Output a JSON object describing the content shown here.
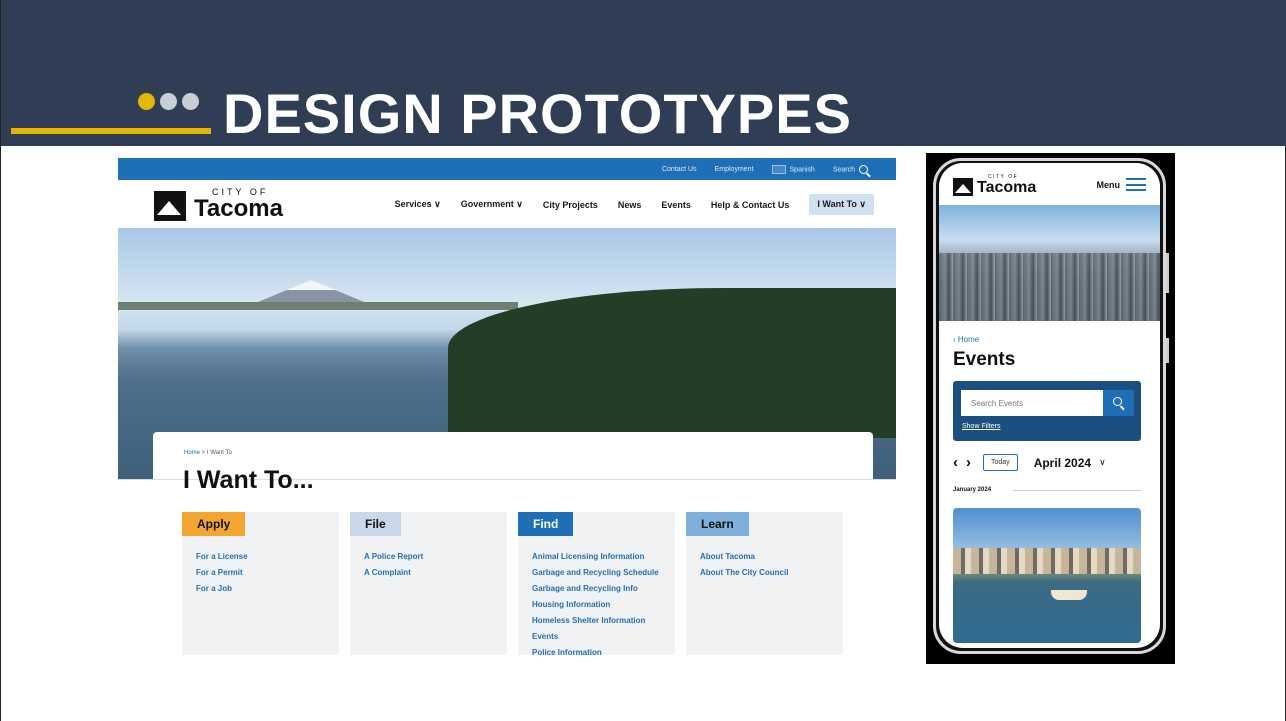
{
  "slide": {
    "title": "DESIGN PROTOTYPES",
    "colors": {
      "header_bg": "#2f3e54",
      "accent": "#e3b600",
      "dot_gray": "#c9cdd4"
    }
  },
  "desktop": {
    "topbar": {
      "contact": "Contact Us",
      "employment": "Employment",
      "spanish": "Spanish",
      "search": "Search"
    },
    "logo": {
      "small": "CITY OF",
      "big": "Tacoma"
    },
    "nav": {
      "services": "Services ∨",
      "government": "Government ∨",
      "city_projects": "City Projects",
      "news": "News",
      "events": "Events",
      "help": "Help & Contact Us",
      "i_want_to": "I Want To ∨"
    },
    "breadcrumb": {
      "home": "Home",
      "sep": " > ",
      "current": "I Want To"
    },
    "page_title": "I Want To...",
    "columns": [
      {
        "label": "Apply",
        "color": "#f2a531",
        "items": [
          "For a License",
          "For a Permit",
          "For a Job"
        ]
      },
      {
        "label": "File",
        "color": "#c9d9ea",
        "items": [
          "A Police Report",
          "A Complaint"
        ]
      },
      {
        "label": "Find",
        "color": "#1f6fb6",
        "items": [
          "Animal Licensing Information",
          "Garbage and Recycling Schedule",
          "Garbage and Recycling Info",
          "Housing Information",
          "Homeless Shelter Information",
          "Events",
          "Police Information"
        ]
      },
      {
        "label": "Learn",
        "color": "#7fb0dc",
        "items": [
          "About Tacoma",
          "About The City Council"
        ]
      }
    ]
  },
  "mobile": {
    "logo": {
      "small": "CITY OF",
      "big": "Tacoma"
    },
    "menu": "Menu",
    "breadcrumb": "‹ Home",
    "title": "Events",
    "search_placeholder": "Search Events",
    "show_filters": "Show Filters",
    "prev": "‹",
    "next": "›",
    "today": "Today",
    "month": "April 2024",
    "section": "January 2024"
  }
}
